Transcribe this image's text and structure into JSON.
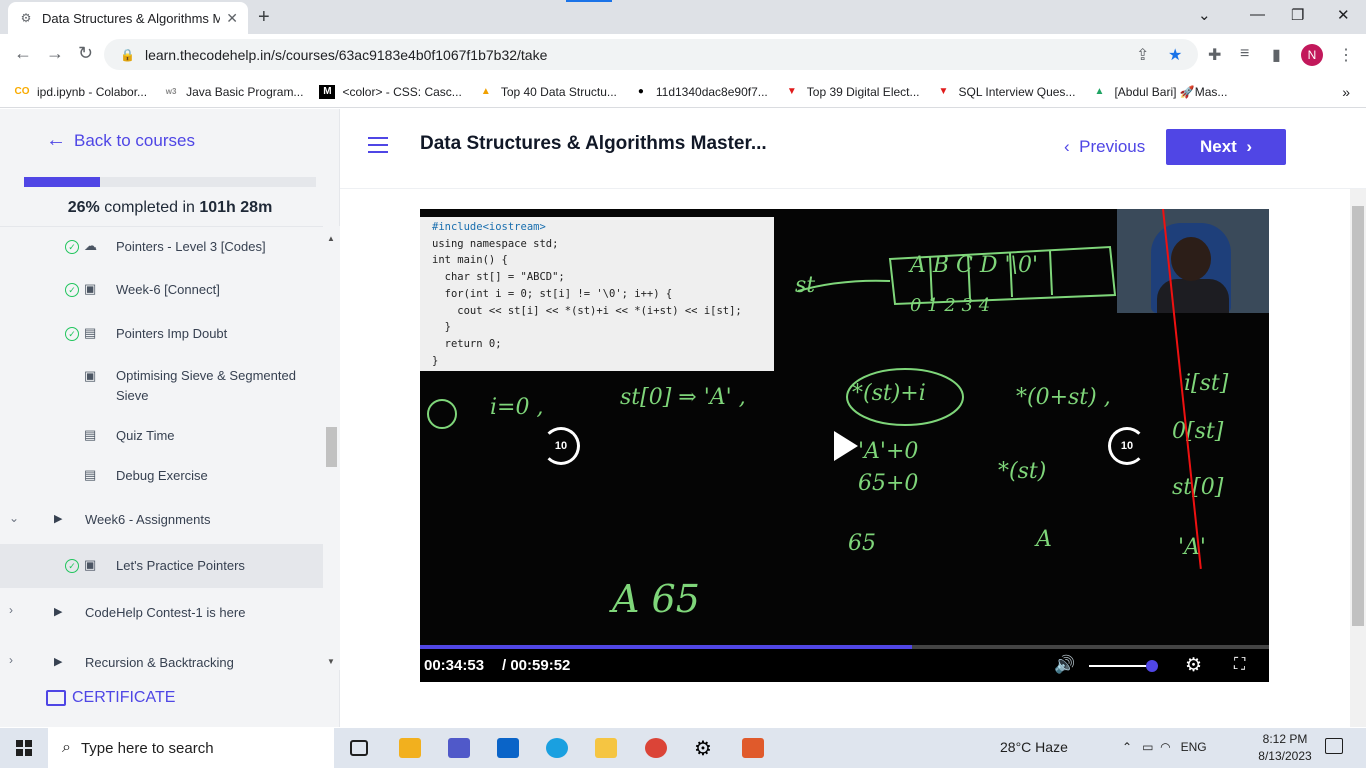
{
  "browser": {
    "tab_title": "Data Structures & Algorithms Ma",
    "url": "learn.thecodehelp.in/s/courses/63ac9183e4b0f1067f1b7b32/take",
    "profile_initial": "N",
    "bookmarks": [
      {
        "label": "ipd.ipynb - Colabor...",
        "icon": "colab-icon",
        "color": "#f9ab00"
      },
      {
        "label": "Java Basic Program...",
        "icon": "w3schools-icon",
        "color": "#888888"
      },
      {
        "label": "<color> - CSS: Casc...",
        "icon": "mdn-icon",
        "color": "#000000"
      },
      {
        "label": "Top 40 Data Structu...",
        "icon": "site-icon",
        "color": "#f0a000"
      },
      {
        "label": "11d1340dac8e90f7...",
        "icon": "github-icon",
        "color": "#000000"
      },
      {
        "label": "Top 39 Digital Elect...",
        "icon": "interviewbit-icon",
        "color": "#e01b1b"
      },
      {
        "label": "SQL Interview Ques...",
        "icon": "interviewbit-icon",
        "color": "#e01b1b"
      },
      {
        "label": "[Abdul Bari] 🚀Mas...",
        "icon": "drive-icon",
        "color": "#1fa463"
      }
    ]
  },
  "sidebar": {
    "back_label": "Back to courses",
    "progress_percent": 26,
    "completed_percent_text": "26%",
    "completed_mid": "completed in",
    "completed_time": "101h 28m",
    "items": [
      {
        "label": "Pointers - Level 3 [Codes]",
        "done": true,
        "icon": "cloud-download-icon"
      },
      {
        "label": "Week-6 [Connect]",
        "done": true,
        "icon": "video-icon"
      },
      {
        "label": "Pointers Imp Doubt",
        "done": true,
        "icon": "document-icon"
      },
      {
        "label": "Optimising Sieve & Segmented Sieve",
        "done": false,
        "icon": "video-icon"
      },
      {
        "label": "Quiz Time",
        "done": false,
        "icon": "quiz-icon"
      },
      {
        "label": "Debug Exercise",
        "done": false,
        "icon": "document-icon"
      }
    ],
    "sections": [
      {
        "label": "Week6 - Assignments",
        "expanded": true
      },
      {
        "label": "CodeHelp Contest-1 is here",
        "expanded": false
      },
      {
        "label": "Recursion & Backtracking",
        "expanded": false
      }
    ],
    "active_item": {
      "label": "Let's Practice Pointers",
      "done": true,
      "icon": "video-icon"
    },
    "certificate_label": "CERTIFICATE"
  },
  "header": {
    "title": "Data Structures & Algorithms Master...",
    "previous_label": "Previous",
    "next_label": "Next"
  },
  "video": {
    "current_time": "00:34:53",
    "total_time": "/ 00:59:52",
    "progress_fraction": 0.58,
    "volume_fraction": 0.92,
    "skip_seconds": "10",
    "code_lines": [
      "#include<iostream>",
      "using namespace std;",
      "int main() {",
      "  char st[] = \"ABCD\";",
      "  for(int i = 0; st[i] != '\\0'; i++) {",
      "    cout << st[i] << *(st)+i << *(i+st) << i[st];",
      "  }",
      "  return 0;",
      "}"
    ]
  },
  "taskbar": {
    "search_placeholder": "Type here to search",
    "weather": "28°C  Haze",
    "language": "ENG",
    "time": "8:12 PM",
    "date": "8/13/2023"
  }
}
